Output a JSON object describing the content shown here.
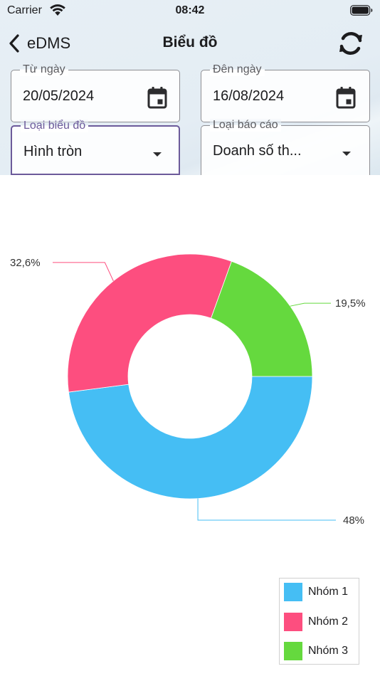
{
  "status_bar": {
    "carrier": "Carrier",
    "time": "08:42"
  },
  "navbar": {
    "back_label": "eDMS",
    "title": "Biểu đồ"
  },
  "filters": {
    "from_date": {
      "label": "Từ ngày",
      "value": "20/05/2024"
    },
    "to_date": {
      "label": "Đên ngày",
      "value": "16/08/2024"
    },
    "chart_type": {
      "label": "Loại biểu đồ",
      "value": "Hình tròn"
    },
    "report_type": {
      "label": "Loại báo cáo",
      "value": "Doanh số th..."
    }
  },
  "chart_data": {
    "type": "pie",
    "categories": [
      "Nhóm 1",
      "Nhóm 2",
      "Nhóm 3"
    ],
    "values": [
      48,
      32.6,
      19.5
    ],
    "labels": [
      "48%",
      "32,6%",
      "19,5%"
    ],
    "colors": [
      "#45bef4",
      "#fd4e7f",
      "#65d93e"
    ],
    "legend_position": "bottom-right",
    "donut": true
  },
  "legend": [
    {
      "label": "Nhóm 1",
      "color": "#45bef4"
    },
    {
      "label": "Nhóm 2",
      "color": "#fd4e7f"
    },
    {
      "label": "Nhóm 3",
      "color": "#65d93e"
    }
  ]
}
